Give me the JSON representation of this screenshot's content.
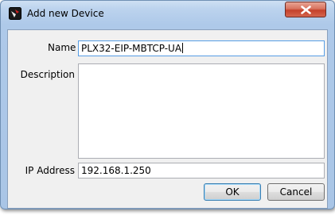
{
  "window": {
    "title": "Add new Device",
    "close_glyph": "x"
  },
  "form": {
    "name_label": "Name",
    "name_value": "PLX32-EIP-MBTCP-UA",
    "description_label": "Description",
    "description_value": "",
    "ip_label": "IP Address",
    "ip_value": "192.168.1.250"
  },
  "buttons": {
    "ok_label": "OK",
    "cancel_label": "Cancel"
  },
  "icons": {
    "app": "device-app-icon",
    "close": "close-icon"
  },
  "colors": {
    "frame": "#a9c5e6",
    "close_button": "#c4402a",
    "focus_border": "#569de5"
  }
}
